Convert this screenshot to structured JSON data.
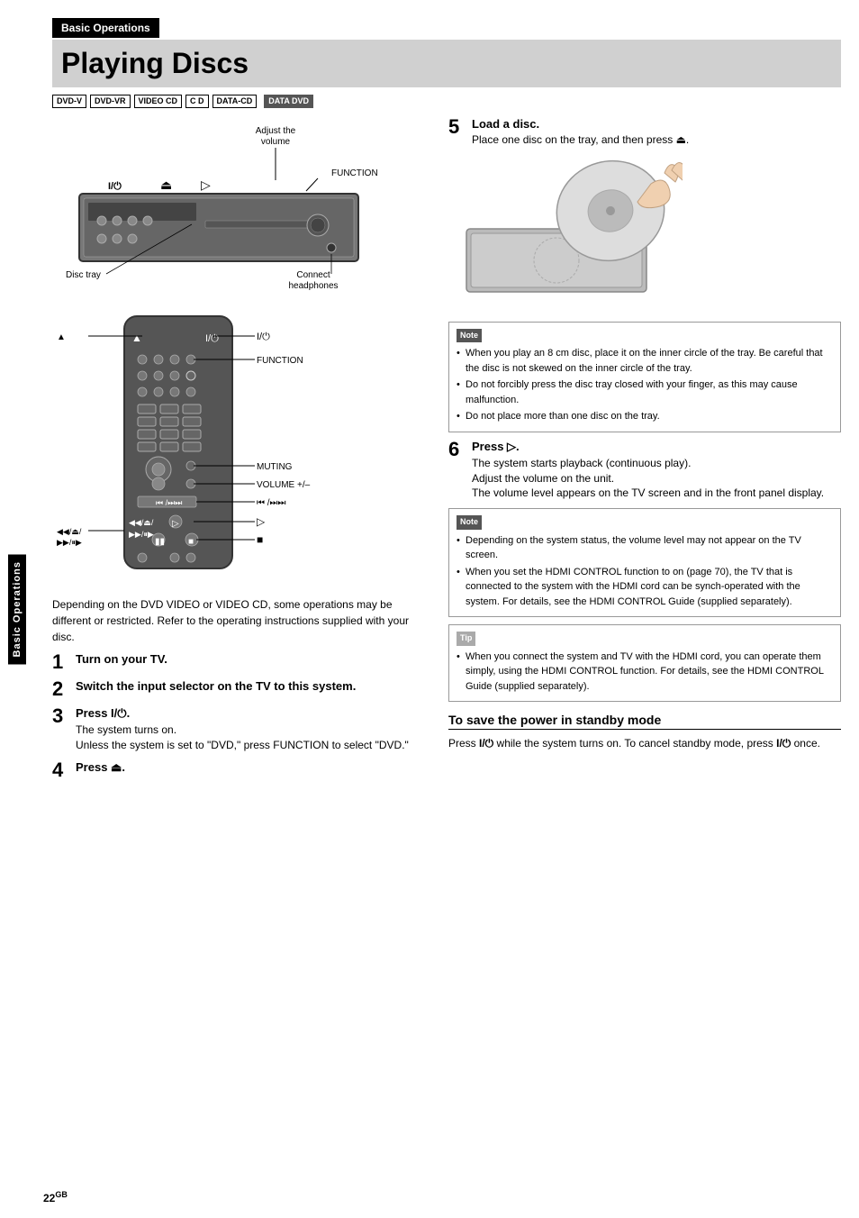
{
  "sidebar": {
    "label": "Basic Operations"
  },
  "header": {
    "section": "Basic Operations",
    "title": "Playing Discs"
  },
  "badges": [
    {
      "text": "DVD-V",
      "dark": false
    },
    {
      "text": "DVD-VR",
      "dark": false
    },
    {
      "text": "VIDEO CD",
      "dark": false
    },
    {
      "text": "C D",
      "dark": false
    },
    {
      "text": "DATA-CD",
      "dark": false
    },
    {
      "text": "DATA DVD",
      "dark": true
    }
  ],
  "intro_text": "Depending on the DVD VIDEO or VIDEO CD, some operations may be different or restricted. Refer to the operating instructions supplied with your disc.",
  "steps": [
    {
      "number": "1",
      "title": "Turn on your TV.",
      "desc": ""
    },
    {
      "number": "2",
      "title": "Switch the input selector on the TV to this system.",
      "desc": ""
    },
    {
      "number": "3",
      "title": "Press I/⏻.",
      "desc": "The system turns on.\nUnless the system is set to “DVD,” press FUNCTION to select “DVD.”"
    },
    {
      "number": "4",
      "title": "Press ⏏.",
      "desc": ""
    },
    {
      "number": "5",
      "title": "Load a disc.",
      "desc": "Place one disc on the tray, and then press ⏏."
    },
    {
      "number": "6",
      "title": "Press ▷.",
      "desc": "The system starts playback (continuous play).\nAdjust the volume on the unit.\nThe volume level appears on the TV screen and in the front panel display."
    }
  ],
  "annotations": {
    "adjust_volume": "Adjust the\nvolume",
    "function": "FUNCTION",
    "disc_tray": "Disc tray",
    "connect_headphones": "Connect\nheadphones",
    "power": "I/⏻",
    "eject": "⏏",
    "muting": "MUTING",
    "volume": "VOLUME +/–",
    "skip": "⏮ /⏭⏭",
    "play": "▷",
    "stop": "■",
    "pause": "⏸",
    "rewind": "◄◄ /⏏/",
    "forward": "►► /⏸►"
  },
  "note1": {
    "label": "Note",
    "items": [
      "When you play an 8 cm disc, place it on the inner circle of the tray. Be careful that the disc is not skewed on the inner circle of the tray.",
      "Do not forcibly press the disc tray closed with your finger, as this may cause malfunction.",
      "Do not place more than one disc on the tray."
    ]
  },
  "note2": {
    "label": "Note",
    "items": [
      "Depending on the system status, the volume level may not appear on the TV screen.",
      "When you set the HDMI CONTROL function to on (page 70), the TV that is connected to the system with the HDMI cord can be synch-operated with the system. For details, see the HDMI CONTROL Guide (supplied separately)."
    ]
  },
  "tip": {
    "label": "Tip",
    "items": [
      "When you connect the system and TV with the HDMI cord, you can operate them simply, using the HDMI CONTROL function. For details, see the HDMI CONTROL Guide (supplied separately)."
    ]
  },
  "standby": {
    "title": "To save the power in standby mode",
    "desc": "Press I/⏻ while the system turns on. To cancel standby mode, press I/⏻ once."
  },
  "page_number": "22",
  "page_suffix": "GB"
}
